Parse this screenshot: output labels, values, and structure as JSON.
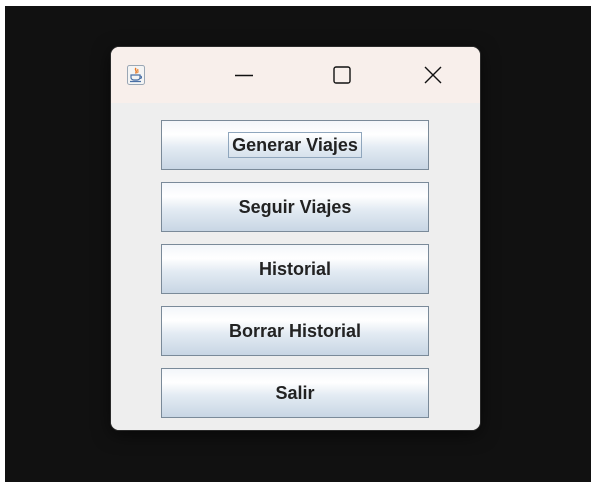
{
  "window": {
    "title": "",
    "app_icon": "java-icon",
    "controls": {
      "minimize": "minimize-icon",
      "maximize": "maximize-icon",
      "close": "close-icon"
    }
  },
  "menu": {
    "buttons": [
      {
        "label": "Generar Viajes",
        "focused": true
      },
      {
        "label": "Seguir Viajes",
        "focused": false
      },
      {
        "label": "Historial",
        "focused": false
      },
      {
        "label": "Borrar Historial",
        "focused": false
      },
      {
        "label": "Salir",
        "focused": false
      }
    ]
  },
  "colors": {
    "titlebar": "#f8efeb",
    "window_bg": "#eeeeee",
    "desktop_bg": "#111111",
    "button_border": "#7a8a99"
  }
}
